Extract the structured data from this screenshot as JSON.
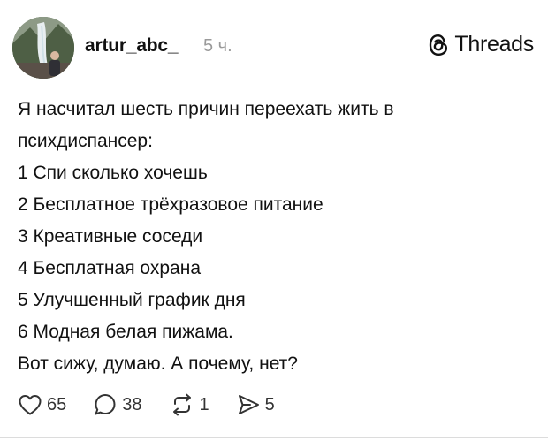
{
  "post": {
    "username": "artur_abc_",
    "time": "5 ч.",
    "lines": [
      "Я насчитал шесть причин переехать жить в",
      "психдиспансер:",
      "1 Спи сколько хочешь",
      "2 Бесплатное трёхразовое питание",
      "3 Креативные соседи",
      "4 Бесплатная охрана",
      "5 Улучшенный график дня",
      "6 Модная белая пижама.",
      "Вот сижу, думаю. А почему, нет?"
    ]
  },
  "brand": {
    "label": "Threads",
    "icon": "threads-logo-icon"
  },
  "actions": {
    "likes": "65",
    "comments": "38",
    "reposts": "1",
    "shares": "5",
    "icons": [
      "heart-icon",
      "comment-icon",
      "repost-icon",
      "share-icon"
    ]
  }
}
